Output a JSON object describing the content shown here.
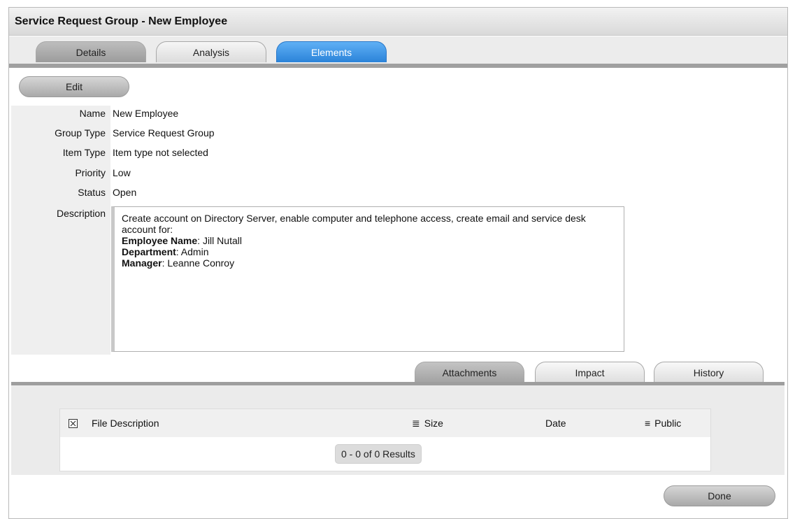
{
  "window": {
    "title": "Service Request Group - New Employee"
  },
  "tabs": [
    {
      "label": "Details",
      "state": "inactive"
    },
    {
      "label": "Analysis",
      "state": "inactive"
    },
    {
      "label": "Elements",
      "state": "active"
    }
  ],
  "toolbar": {
    "edit_label": "Edit"
  },
  "fields": {
    "name": {
      "label": "Name",
      "value": "New Employee"
    },
    "group_type": {
      "label": "Group Type",
      "value": "Service Request Group"
    },
    "item_type": {
      "label": "Item Type",
      "value": "Item type not selected"
    },
    "priority": {
      "label": "Priority",
      "value": "Low"
    },
    "status": {
      "label": "Status",
      "value": "Open"
    },
    "description": {
      "label": "Description",
      "intro": "Create account on Directory Server, enable computer and telephone access, create email and service desk account for:",
      "employee_label": "Employee Name",
      "employee_value": ": Jill Nutall",
      "department_label": "Department",
      "department_value": ": Admin",
      "manager_label": "Manager",
      "manager_value": ": Leanne Conroy"
    }
  },
  "subtabs": [
    {
      "label": "Attachments",
      "state": "active"
    },
    {
      "label": "Impact",
      "state": "inactive"
    },
    {
      "label": "History",
      "state": "inactive"
    }
  ],
  "attachments_table": {
    "columns": {
      "file_description": "File Description",
      "size": "Size",
      "date": "Date",
      "public": "Public"
    },
    "icons": {
      "select_all": "checkbox-x-icon",
      "size_sort": "list-icon",
      "public_filter": "filter-icon"
    },
    "results": "0 - 0 of 0 Results"
  },
  "footer": {
    "done_label": "Done"
  },
  "colors": {
    "active_tab": "#2b83d9",
    "tab_gray": "#a9a9a9"
  }
}
